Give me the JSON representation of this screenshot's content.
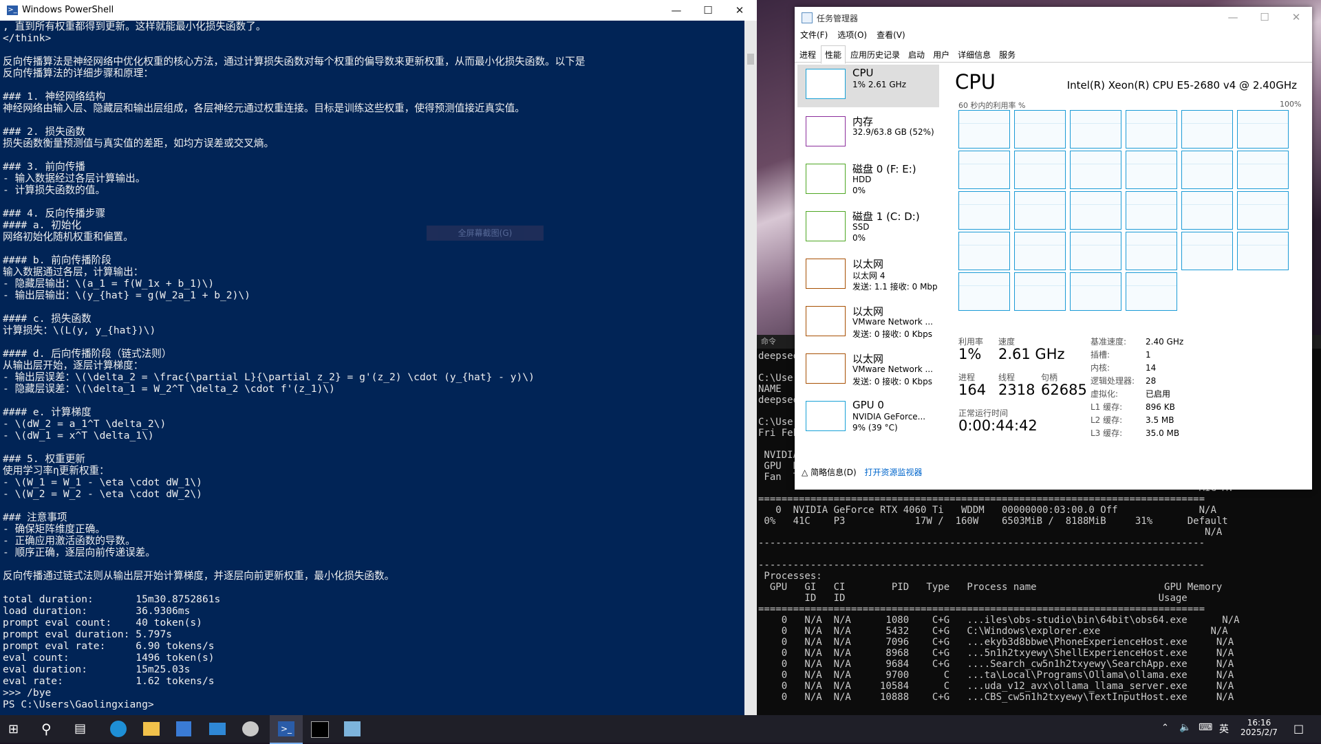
{
  "powershell": {
    "title": "Windows PowerShell",
    "tooltip": "全屏幕截图(G)",
    "lines": [
      ", 直到所有权重都得到更新。这样就能最小化损失函数了。",
      "</think>",
      "",
      "反向传播算法是神经网络中优化权重的核心方法，通过计算损失函数对每个权重的偏导数来更新权重，从而最小化损失函数。以下是",
      "反向传播算法的详细步骤和原理：",
      "",
      "### 1. 神经网络结构",
      "神经网络由输入层、隐藏层和输出层组成，各层神经元通过权重连接。目标是训练这些权重，使得预测值接近真实值。",
      "",
      "### 2. 损失函数",
      "损失函数衡量预测值与真实值的差距，如均方误差或交叉熵。",
      "",
      "### 3. 前向传播",
      "- 输入数据经过各层计算输出。",
      "- 计算损失函数的值。",
      "",
      "### 4. 反向传播步骤",
      "#### a. 初始化",
      "网络初始化随机权重和偏置。",
      "",
      "#### b. 前向传播阶段",
      "输入数据通过各层，计算输出：",
      "- 隐藏层输出：\\(a_1 = f(W_1x + b_1)\\)",
      "- 输出层输出：\\(y_{hat} = g(W_2a_1 + b_2)\\)",
      "",
      "#### c. 损失函数",
      "计算损失：\\(L(y, y_{hat})\\)",
      "",
      "#### d. 后向传播阶段（链式法则）",
      "从输出层开始，逐层计算梯度：",
      "- 输出层误差：\\(\\delta_2 = \\frac{\\partial L}{\\partial z_2} = g'(z_2) \\cdot (y_{hat} - y)\\)",
      "- 隐藏层误差：\\(\\delta_1 = W_2^T \\delta_2 \\cdot f'(z_1)\\)",
      "",
      "#### e. 计算梯度",
      "- \\(dW_2 = a_1^T \\delta_2\\)",
      "- \\(dW_1 = x^T \\delta_1\\)",
      "",
      "### 5. 权重更新",
      "使用学习率η更新权重：",
      "- \\(W_1 = W_1 - \\eta \\cdot dW_1\\)",
      "- \\(W_2 = W_2 - \\eta \\cdot dW_2\\)",
      "",
      "### 注意事项",
      "- 确保矩阵维度正确。",
      "- 正确应用激活函数的导数。",
      "- 顺序正确，逐层向前传递误差。",
      "",
      "反向传播通过链式法则从输出层开始计算梯度，并逐层向前更新权重，最小化损失函数。",
      "",
      "total duration:       15m30.8752861s",
      "load duration:        36.9306ms",
      "prompt eval count:    40 token(s)",
      "prompt eval duration: 5.797s",
      "prompt eval rate:     6.90 tokens/s",
      "eval count:           1496 token(s)",
      "eval duration:        15m25.03s",
      "eval rate:            1.62 tokens/s",
      ">>> /bye",
      "PS C:\\Users\\Gaolingxiang>"
    ]
  },
  "cmd": {
    "title": "命令",
    "lines": [
      "deepseek",
      "",
      "C:\\Users",
      "NAME",
      "deepseek",
      "",
      "C:\\Users",
      "Fri Feb",
      "",
      " NVIDIA",
      " GPU  N",
      " Fan  Temp   Perf          Pwr:Usage/Cap         Memory-Usage   GPU-Util  Compute M.",
      "                                                                            MIG M.",
      "=============================================================================",
      "   0  NVIDIA GeForce RTX 4060 Ti   WDDM   00000000:03:00.0 Off              N/A",
      " 0%   41C    P3            17W /  160W    6503MiB /  8188MiB     31%      Default",
      "                                                                             N/A",
      "-----------------------------------------------------------------------------",
      "",
      "-----------------------------------------------------------------------------",
      " Processes:",
      "  GPU   GI   CI        PID   Type   Process name                      GPU Memory",
      "        ID   ID                                                      Usage",
      "=============================================================================",
      "    0   N/A  N/A      1080    C+G   ...iles\\obs-studio\\bin\\64bit\\obs64.exe      N/A",
      "    0   N/A  N/A      5432    C+G   C:\\Windows\\explorer.exe                   N/A",
      "    0   N/A  N/A      7096    C+G   ...ekyb3d8bbwe\\PhoneExperienceHost.exe     N/A",
      "    0   N/A  N/A      8968    C+G   ...5n1h2txyewy\\ShellExperienceHost.exe     N/A",
      "    0   N/A  N/A      9684    C+G   ....Search_cw5n1h2txyewy\\SearchApp.exe     N/A",
      "    0   N/A  N/A      9700      C   ...ta\\Local\\Programs\\Ollama\\ollama.exe     N/A",
      "    0   N/A  N/A     10584      C   ...uda_v12_avx\\ollama_llama_server.exe     N/A",
      "    0   N/A  N/A     10888    C+G   ...CBS_cw5n1h2txyewy\\TextInputHost.exe     N/A"
    ]
  },
  "taskmgr": {
    "title": "任务管理器",
    "menu": [
      "文件(F)",
      "选项(O)",
      "查看(V)"
    ],
    "tabs": [
      "进程",
      "性能",
      "应用历史记录",
      "启动",
      "用户",
      "详细信息",
      "服务"
    ],
    "active_tab": 1,
    "resources": [
      {
        "name": "CPU",
        "sub1": "1% 2.61 GHz",
        "sub2": "",
        "color": "#17a0d6"
      },
      {
        "name": "内存",
        "sub1": "32.9/63.8 GB (52%)",
        "sub2": "",
        "color": "#8b2d9b"
      },
      {
        "name": "磁盘 0 (F: E:)",
        "sub1": "HDD",
        "sub2": "0%",
        "color": "#4da622"
      },
      {
        "name": "磁盘 1 (C: D:)",
        "sub1": "SSD",
        "sub2": "0%",
        "color": "#4da622"
      },
      {
        "name": "以太网",
        "sub1": "以太网 4",
        "sub2": "发送: 1.1 接收: 0 Mbp",
        "color": "#a74f01"
      },
      {
        "name": "以太网",
        "sub1": "VMware Network ...",
        "sub2": "发送: 0 接收: 0 Kbps",
        "color": "#a74f01"
      },
      {
        "name": "以太网",
        "sub1": "VMware Network ...",
        "sub2": "发送: 0 接收: 0 Kbps",
        "color": "#a74f01"
      },
      {
        "name": "GPU 0",
        "sub1": "NVIDIA GeForce...",
        "sub2": "9% (39 °C)",
        "color": "#17a0d6"
      }
    ],
    "cpu_heading": "CPU",
    "cpu_model": "Intel(R) Xeon(R) CPU E5-2680 v4 @ 2.40GHz",
    "util_label": "60 秒内的利用率 %",
    "util_max": "100%",
    "core_count_graphs": 28,
    "stats": {
      "util_label": "利用率",
      "util": "1%",
      "speed_label": "速度",
      "speed": "2.61 GHz",
      "proc_label": "进程",
      "proc": "164",
      "thread_label": "线程",
      "thread": "2318",
      "handle_label": "句柄",
      "handle": "62685",
      "uptime_label": "正常运行时间",
      "uptime": "0:00:44:42"
    },
    "details": [
      {
        "k": "基准速度:",
        "v": "2.40 GHz"
      },
      {
        "k": "插槽:",
        "v": "1"
      },
      {
        "k": "内核:",
        "v": "14"
      },
      {
        "k": "逻辑处理器:",
        "v": "28"
      },
      {
        "k": "虚拟化:",
        "v": "已启用"
      },
      {
        "k": "L1 缓存:",
        "v": "896 KB"
      },
      {
        "k": "L2 缓存:",
        "v": "3.5 MB"
      },
      {
        "k": "L3 缓存:",
        "v": "35.0 MB"
      }
    ],
    "footer_brief": "简略信息(D)",
    "footer_link": "打开资源监视器"
  },
  "taskbar": {
    "time": "16:16",
    "date": "2025/2/7",
    "ime": "英"
  }
}
